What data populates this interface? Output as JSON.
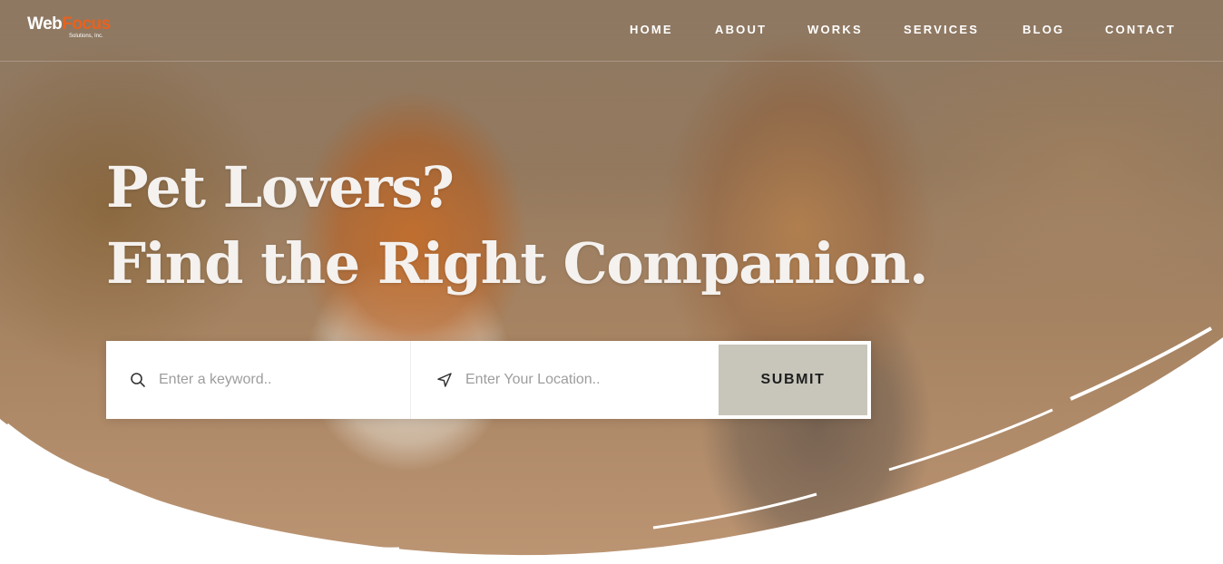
{
  "brand": {
    "logo_word_1": "Web",
    "logo_word_2": "Focus",
    "logo_tagline": "Solutions, Inc.",
    "accent_color": "#e8621e"
  },
  "nav": {
    "items": [
      {
        "label": "HOME"
      },
      {
        "label": "ABOUT"
      },
      {
        "label": "WORKS"
      },
      {
        "label": "SERVICES"
      },
      {
        "label": "BLOG"
      },
      {
        "label": "CONTACT"
      }
    ]
  },
  "hero": {
    "headline_line_1": "Pet Lovers?",
    "headline_line_2": "Find the Right Companion.",
    "background_image": "corgi-and-terrier-running-on-path",
    "curve_color": "#ffffff"
  },
  "search": {
    "keyword_placeholder": "Enter a keyword..",
    "keyword_icon": "search-icon",
    "location_placeholder": "Enter Your Location..",
    "location_icon": "location-arrow-icon",
    "submit_label": "SUBMIT",
    "submit_color": "#c8c6bb"
  }
}
